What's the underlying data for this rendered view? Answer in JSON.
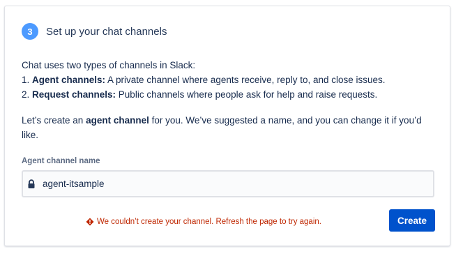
{
  "step": {
    "number": "3",
    "title": "Set up your chat channels"
  },
  "intro": {
    "line1": "Chat uses two types of channels in Slack:",
    "item1_prefix": "1. ",
    "item1_bold": "Agent channels:",
    "item1_text": " A private channel where agents receive, reply to, and close issues.",
    "item2_prefix": "2. ",
    "item2_bold": "Request channels:",
    "item2_text": " Public channels where people ask for help and raise requests."
  },
  "suggestion": {
    "pre": "Let’s create an ",
    "bold": "agent channel",
    "post": " for you. We’ve suggested a name, and you can change it if you’d like."
  },
  "field": {
    "label": "Agent channel name",
    "value": "agent-itsample",
    "icon": "lock-icon"
  },
  "error": {
    "icon": "error-icon",
    "message": "We couldn’t create your channel. Refresh the page to try again."
  },
  "actions": {
    "create_label": "Create"
  },
  "colors": {
    "accent": "#0052cc",
    "step_badge": "#4c9aff",
    "error": "#bf2600",
    "text": "#172b4d"
  }
}
